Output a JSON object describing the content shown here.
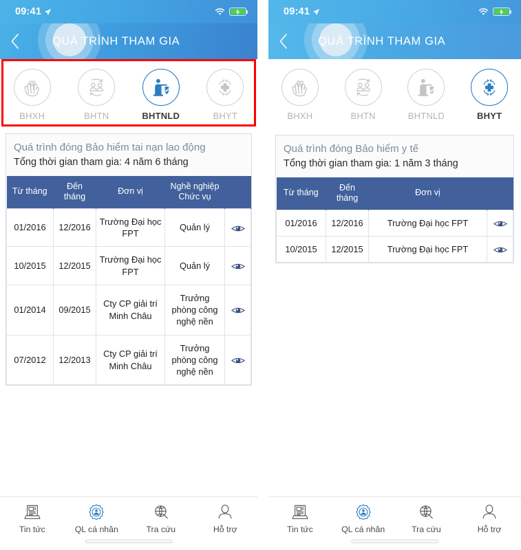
{
  "screen": {
    "status_bar": {
      "time": "09:41",
      "location_icon": "location-arrow-icon",
      "wifi_icon": "wifi-icon",
      "battery_icon": "battery-charging-icon"
    },
    "nav": {
      "back_icon": "chevron-left-icon",
      "title": "QUÁ TRÌNH THAM GIA"
    },
    "bottom_tabs": [
      {
        "label": "Tin tức",
        "icon": "news-icon"
      },
      {
        "label": "QL cá nhân",
        "icon": "personal-gear-icon"
      },
      {
        "label": "Tra cứu",
        "icon": "search-lookup-icon"
      },
      {
        "label": "Hỗ trợ",
        "icon": "support-person-icon"
      }
    ]
  },
  "left_panel": {
    "categories": [
      {
        "label": "BHXH",
        "icon": "hands-heart-icon",
        "active": false
      },
      {
        "label": "BHTN",
        "icon": "people-exchange-icon",
        "active": false
      },
      {
        "label": "BHTNLD",
        "icon": "worker-shield-icon",
        "active": true
      },
      {
        "label": "BHYT",
        "icon": "medical-cross-icon",
        "active": false
      }
    ],
    "highlight_color": "#ff0000",
    "card": {
      "title": "Quá trình đóng Bảo hiểm tai nạn lao động",
      "subtitle": "Tổng thời gian tham gia: 4 năm 6 tháng",
      "columns": [
        "Từ tháng",
        "Đến tháng",
        "Đơn vị",
        "Nghề nghiệp Chức vụ",
        ""
      ],
      "rows": [
        {
          "from": "01/2016",
          "to": "12/2016",
          "unit": "Trường Đại học FPT",
          "job": "Quản lý",
          "action_icon": "eye-icon"
        },
        {
          "from": "10/2015",
          "to": "12/2015",
          "unit": "Trường Đại học FPT",
          "job": "Quản lý",
          "action_icon": "eye-icon"
        },
        {
          "from": "01/2014",
          "to": "09/2015",
          "unit": "Cty CP giải trí Minh Châu",
          "job": "Trưởng phòng công nghệ nền",
          "action_icon": "eye-icon"
        },
        {
          "from": "07/2012",
          "to": "12/2013",
          "unit": "Cty CP giải trí Minh Châu",
          "job": "Trưởng phòng công nghệ nền",
          "action_icon": "eye-icon"
        }
      ]
    }
  },
  "right_panel": {
    "categories": [
      {
        "label": "BHXH",
        "icon": "hands-heart-icon",
        "active": false
      },
      {
        "label": "BHTN",
        "icon": "people-exchange-icon",
        "active": false
      },
      {
        "label": "BHTNLD",
        "icon": "worker-shield-icon",
        "active": false
      },
      {
        "label": "BHYT",
        "icon": "medical-cross-icon",
        "active": true
      }
    ],
    "card": {
      "title": "Quá trình đóng Bảo hiểm y tế",
      "subtitle": "Tổng thời gian tham gia: 1 năm 3 tháng",
      "columns": [
        "Từ tháng",
        "Đến tháng",
        "Đơn vị",
        ""
      ],
      "rows": [
        {
          "from": "01/2016",
          "to": "12/2016",
          "unit": "Trường Đại học FPT",
          "action_icon": "eye-icon"
        },
        {
          "from": "10/2015",
          "to": "12/2015",
          "unit": "Trường Đại học FPT",
          "action_icon": "eye-icon"
        }
      ]
    }
  },
  "colors": {
    "header_blue": "#3f9fe0",
    "table_header_blue": "#41609c",
    "accent_blue": "#1f72bd",
    "highlight_red": "#ff0000",
    "inactive_gray": "#b4b4b4"
  }
}
